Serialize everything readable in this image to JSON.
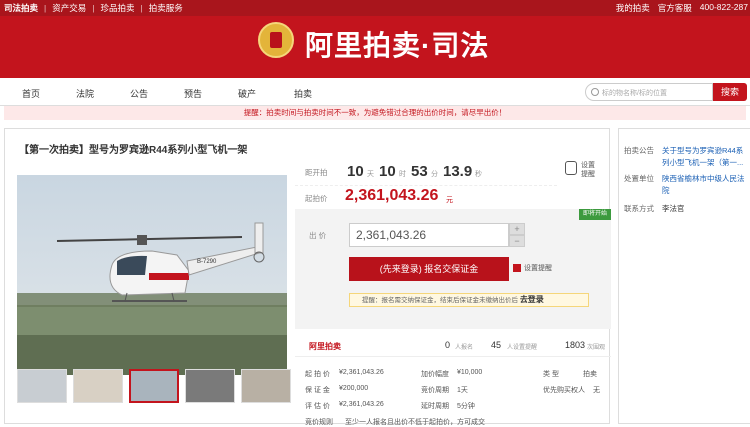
{
  "topbar": {
    "left": [
      "司法拍卖",
      "资产交易",
      "珍品拍卖",
      "拍卖服务"
    ],
    "right": [
      "我的拍卖",
      "官方客服",
      "400-822-287"
    ]
  },
  "header": {
    "brand": "阿里拍卖·司法"
  },
  "nav": {
    "items": [
      "首页",
      "法院",
      "公告",
      "预告",
      "破产",
      "拍卖"
    ],
    "search_placeholder": "标的物名称/标的位置",
    "search_button": "搜索"
  },
  "warning": "提醒：拍卖时间与拍卖时间不一致，为避免错过合理的出价时间，请尽早出价！",
  "item": {
    "title": "【第一次拍卖】型号为罗宾逊R44系列小型飞机一架",
    "countdown_label": "距开拍",
    "days": "10",
    "days_unit": "天",
    "hours": "10",
    "hours_unit": "时",
    "minutes": "53",
    "minutes_unit": "分",
    "seconds": "13.9",
    "seconds_unit": "秒",
    "remind_label": "设置提醒",
    "price_label": "起拍价",
    "price": "2,361,043.26",
    "price_unit": "元",
    "status_badge": "即将开始",
    "bid_label": "出 价",
    "bid_value": "2,361,043.26",
    "plus": "+",
    "minus": "−",
    "register_button": "(先来登录) 报名交保证金",
    "reminder_link": "设置提醒",
    "tip_text": "提醒：报名需交纳保证金，结束后保证金未缴纳出价后 ",
    "tip_login": "去登录",
    "platform": "阿里拍卖",
    "stats": [
      {
        "value": "0",
        "label": "人报名"
      },
      {
        "value": "45",
        "label": "人设置提醒"
      },
      {
        "value": "1803",
        "label": "次围观"
      }
    ],
    "details": [
      {
        "label": "起 拍 价",
        "value": "¥2,361,043.26"
      },
      {
        "label": "加价幅度",
        "value": "¥10,000"
      },
      {
        "label": "类    型",
        "value": "拍卖"
      },
      {
        "label": "保 证 金",
        "value": "¥200,000"
      },
      {
        "label": "竞价周期",
        "value": "1天"
      },
      {
        "label": "优先购买权人",
        "value": "无"
      },
      {
        "label": "评 估 价",
        "value": "¥2,361,043.26"
      },
      {
        "label": "延时周期",
        "value": "5分钟"
      }
    ],
    "rule_label": "竞价规则",
    "rule_value": "至少一人报名且出价不低于起拍价，方可成交"
  },
  "side": {
    "notice_label": "拍卖公告",
    "notice_value": "关于型号为罗宾逊R44系列小型飞机一架（第一...",
    "unit_label": "处置单位",
    "unit_value": "陕西省榆林市中级人民法院",
    "contact_label": "联系方式",
    "contact_value": "李法官"
  }
}
